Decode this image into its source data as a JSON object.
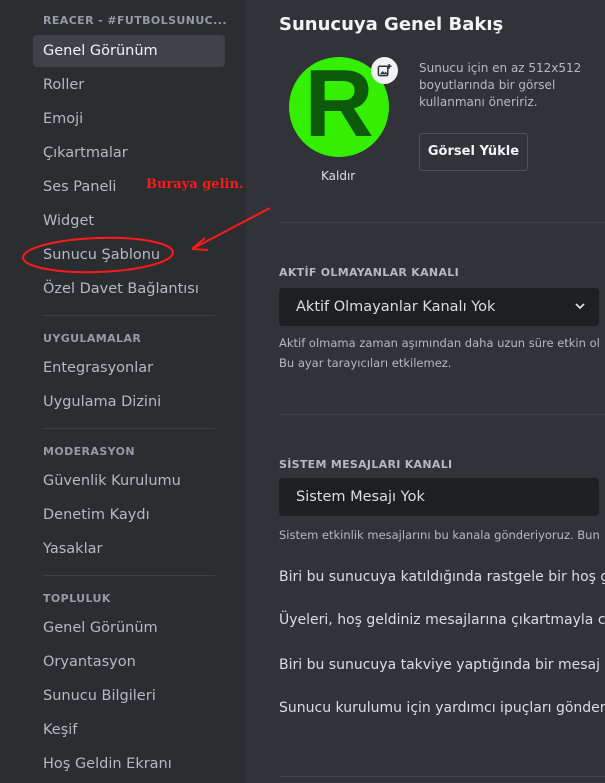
{
  "sidebar": {
    "server_header": "REACER - #FUTBOLSUNUC...",
    "items": [
      "Genel Görünüm",
      "Roller",
      "Emoji",
      "Çıkartmalar",
      "Ses Paneli",
      "Widget",
      "Sunucu Şablonu",
      "Özel Davet Bağlantısı"
    ],
    "apps_header": "UYGULAMALAR",
    "apps_items": [
      "Entegrasyonlar",
      "Uygulama Dizini"
    ],
    "mod_header": "MODERASYON",
    "mod_items": [
      "Güvenlik Kurulumu",
      "Denetim Kaydı",
      "Yasaklar"
    ],
    "community_header": "TOPLULUK",
    "community_items": [
      "Genel Görünüm",
      "Oryantasyon",
      "Sunucu Bilgileri",
      "Keşif",
      "Hoş Geldin Ekranı"
    ]
  },
  "annotation": {
    "text": "Buraya gelin.",
    "color": "#ff1a1a"
  },
  "main": {
    "title": "Sunucuya Genel Bakış",
    "icon_letter": "R",
    "icon_color": "#34f000",
    "remove_label": "Kaldır",
    "icon_hint": "Sunucu için en az 512x512 boyutlarında bir görsel kullanmanı öneririz.",
    "upload_button": "Görsel Yükle",
    "inactive_header": "AKTİF OLMAYANLAR KANALI",
    "inactive_value": "Aktif Olmayanlar Kanalı Yok",
    "inactive_help1": "Aktif olmama zaman aşımından daha uzun süre etkin ol",
    "inactive_help2": "Bu ayar tarayıcıları etkilemez.",
    "system_header": "SİSTEM MESAJLARI KANALI",
    "system_value": "Sistem Mesajı Yok",
    "system_help": "Sistem etkinlik mesajlarını bu kanala gönderiyoruz. Bun",
    "options": [
      "Biri bu sunucuya katıldığında rastgele bir hoş ge",
      "Üyeleri, hoş geldiniz mesajlarına çıkartmayla cev",
      "Biri bu sunucuya takviye yaptığında bir mesaj gö",
      "Sunucu kurulumu için yardımcı ipuçları gönder."
    ]
  }
}
